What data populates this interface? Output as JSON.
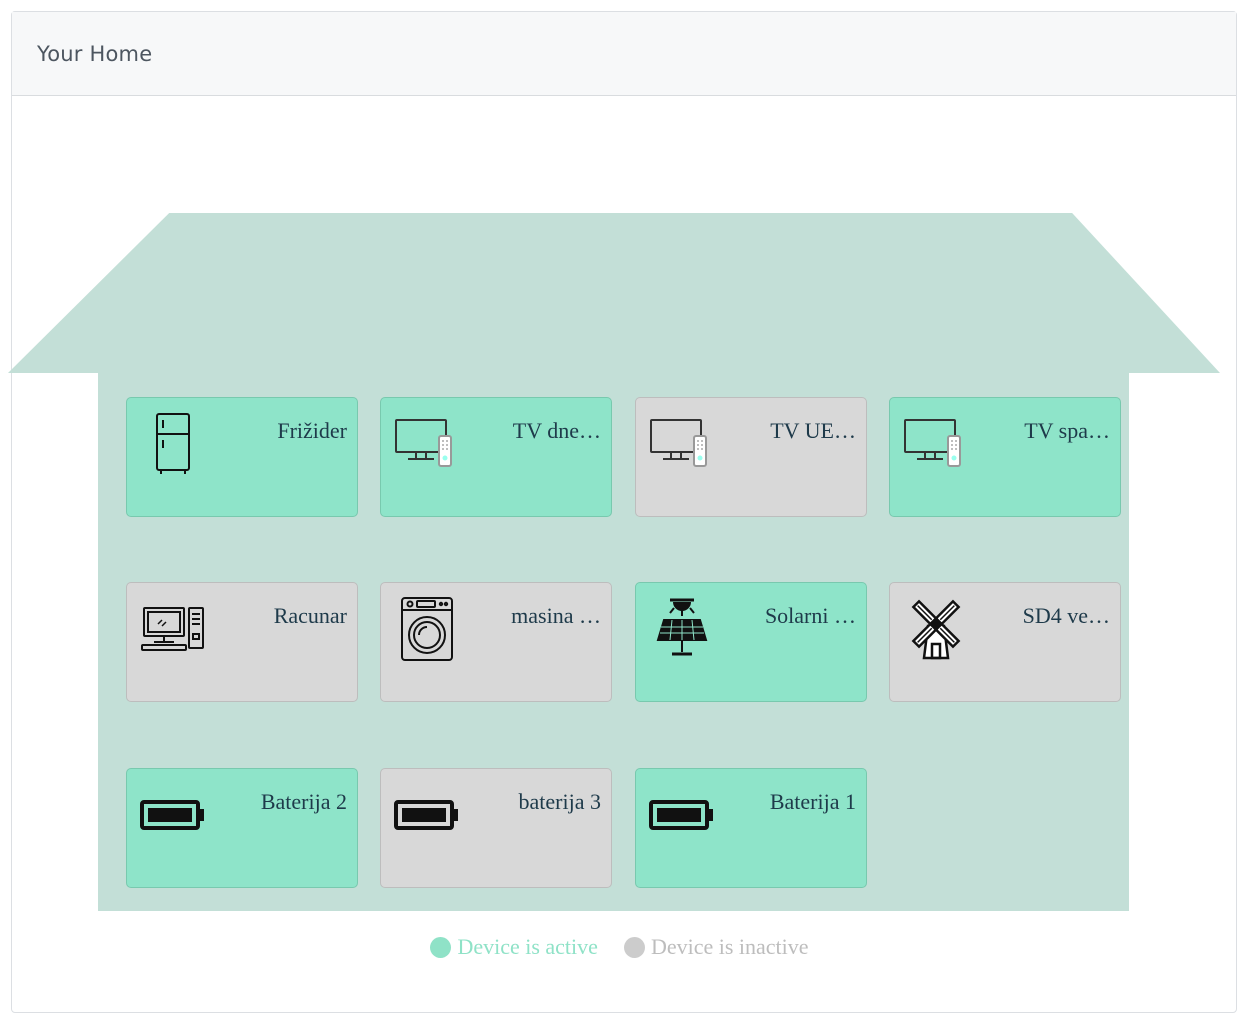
{
  "header": {
    "title": "Your Home"
  },
  "colors": {
    "active": "#8ee4c9",
    "inactive": "#d8d8d8",
    "house": "#c3dfd7"
  },
  "devices": [
    {
      "name": "Frižider",
      "icon": "fridge-icon",
      "active": true
    },
    {
      "name": "TV dne…",
      "icon": "tv-icon",
      "active": true
    },
    {
      "name": "TV UE…",
      "icon": "tv-icon",
      "active": false
    },
    {
      "name": "TV spa…",
      "icon": "tv-icon",
      "active": true
    },
    {
      "name": "Racunar",
      "icon": "computer-icon",
      "active": false
    },
    {
      "name": "masina …",
      "icon": "washing-machine-icon",
      "active": false
    },
    {
      "name": "Solarni …",
      "icon": "solar-panel-icon",
      "active": true
    },
    {
      "name": "SD4 ve…",
      "icon": "windmill-icon",
      "active": false
    },
    {
      "name": "Baterija 2",
      "icon": "battery-icon",
      "active": true
    },
    {
      "name": "baterija 3",
      "icon": "battery-icon",
      "active": false
    },
    {
      "name": "Baterija 1",
      "icon": "battery-icon",
      "active": true
    }
  ],
  "legend": {
    "active_label": "Device is active",
    "inactive_label": "Device is inactive"
  }
}
